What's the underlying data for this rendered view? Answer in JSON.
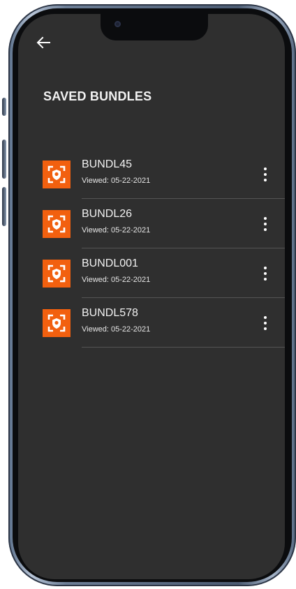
{
  "header": {
    "back_icon": "arrow-left-icon",
    "title": "SAVED BUNDLES"
  },
  "bundles": [
    {
      "name": "BUNDL45",
      "viewed": "Viewed: 05-22-2021",
      "icon": "shield-scan-icon",
      "menu_icon": "more-vertical-icon"
    },
    {
      "name": "BUNDL26",
      "viewed": "Viewed: 05-22-2021",
      "icon": "shield-scan-icon",
      "menu_icon": "more-vertical-icon"
    },
    {
      "name": "BUNDL001",
      "viewed": "Viewed: 05-22-2021",
      "icon": "shield-scan-icon",
      "menu_icon": "more-vertical-icon"
    },
    {
      "name": "BUNDL578",
      "viewed": "Viewed: 05-22-2021",
      "icon": "shield-scan-icon",
      "menu_icon": "more-vertical-icon"
    }
  ],
  "colors": {
    "background": "#2f2f2f",
    "accent": "#f2600f",
    "text": "#f2f2f2",
    "divider": "#555555"
  }
}
